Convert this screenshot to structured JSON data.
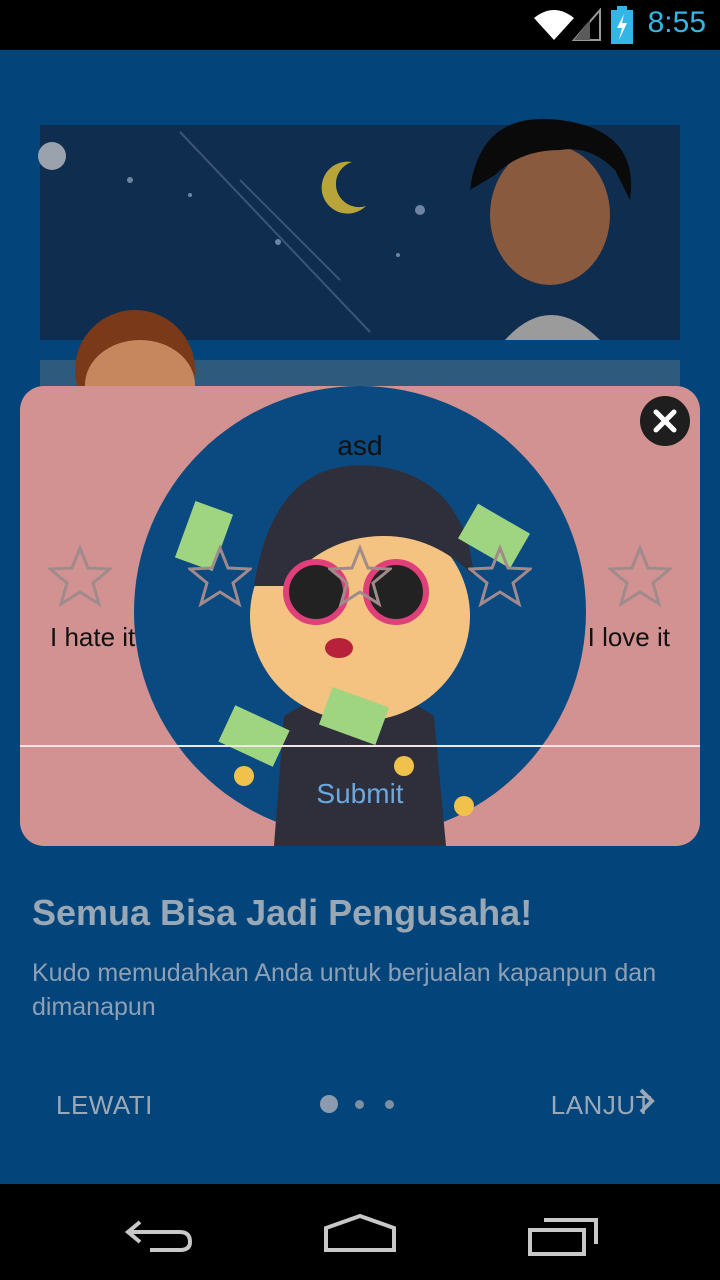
{
  "status_bar": {
    "time": "8:55"
  },
  "onboarding": {
    "title": "Semua Bisa Jadi Pengusaha!",
    "description": "Kudo memudahkan Anda untuk berjualan kapanpun dan dimanapun",
    "skip_label": "LEWATI",
    "next_label": "LANJUT",
    "page_count": 3,
    "current_page": 1
  },
  "rating_dialog": {
    "title": "asd",
    "star_count": 5,
    "selected_stars": 0,
    "label_low": "I hate it",
    "label_high": "I love it",
    "submit_label": "Submit"
  },
  "colors": {
    "background": "#03457a",
    "dialog": "#d29291",
    "submit": "#6aa8e0",
    "status_time": "#33b5e5"
  },
  "icons": [
    "wifi-icon",
    "signal-icon",
    "battery-charging-icon",
    "close-icon",
    "star-outline-icon",
    "chevron-right-icon",
    "back-icon",
    "home-icon",
    "recents-icon"
  ]
}
